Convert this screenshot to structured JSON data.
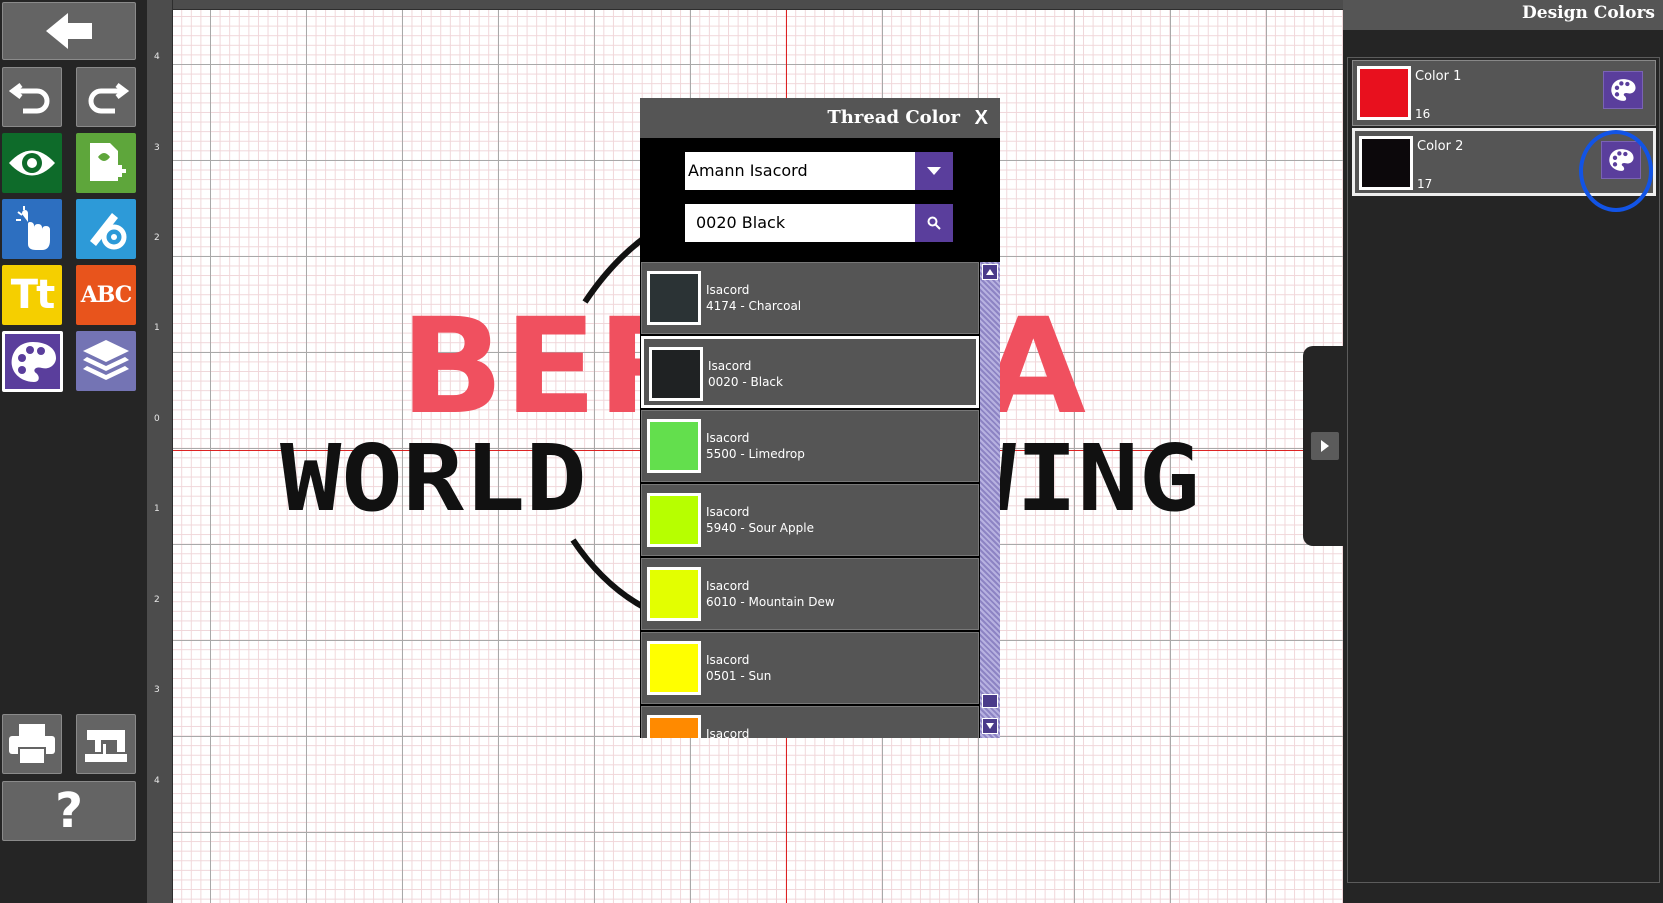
{
  "toolbar": {
    "buttons": [
      {
        "name": "back-button",
        "icon": "back-arrow-icon"
      },
      {
        "name": "undo-button",
        "icon": "undo-icon"
      },
      {
        "name": "redo-button",
        "icon": "redo-icon"
      },
      {
        "name": "view-button",
        "icon": "eye-icon"
      },
      {
        "name": "add-design-button",
        "icon": "add-design-icon"
      },
      {
        "name": "select-button",
        "icon": "pointer-hand-icon"
      },
      {
        "name": "edit-settings-button",
        "icon": "edit-gear-icon"
      },
      {
        "name": "text-button",
        "icon": "text-tt-icon",
        "label": "Tt"
      },
      {
        "name": "monogram-button",
        "icon": "monogram-abc-icon",
        "label": "ABC"
      },
      {
        "name": "colors-button",
        "icon": "palette-icon"
      },
      {
        "name": "layers-button",
        "icon": "layers-icon"
      },
      {
        "name": "print-button",
        "icon": "printer-icon"
      },
      {
        "name": "sew-button",
        "icon": "sewing-machine-icon"
      },
      {
        "name": "help-button",
        "icon": "help-icon",
        "label": "?"
      }
    ]
  },
  "ruler": {
    "left_labels": [
      "4",
      "3",
      "2",
      "1",
      "0",
      "1",
      "2",
      "3",
      "4"
    ]
  },
  "design": {
    "top_text": "BERNINA",
    "bottom_text": "WORLD OF SEWING",
    "top_color": "#f0505f",
    "bottom_color": "#111111"
  },
  "thread_dialog": {
    "title": "Thread Color",
    "close_label": "X",
    "brand": "Amann Isacord",
    "search_value": "0020 Black",
    "threads": [
      {
        "brand": "Isacord",
        "name": "4174 - Charcoal",
        "color": "#2b3335"
      },
      {
        "brand": "Isacord",
        "name": "0020 - Black",
        "color": "#1f2223",
        "selected": true
      },
      {
        "brand": "Isacord",
        "name": "5500 - Limedrop",
        "color": "#63df4d"
      },
      {
        "brand": "Isacord",
        "name": "5940 - Sour Apple",
        "color": "#b7ff00"
      },
      {
        "brand": "Isacord",
        "name": "6010 - Mountain Dew",
        "color": "#e3ff00"
      },
      {
        "brand": "Isacord",
        "name": "0501 - Sun",
        "color": "#ffff00"
      },
      {
        "brand": "Isacord",
        "name": "",
        "color": "#ff8a00"
      }
    ]
  },
  "design_colors": {
    "title": "Design Colors",
    "colors": [
      {
        "name": "Color 1",
        "count": "16",
        "color": "#e8101e"
      },
      {
        "name": "Color 2",
        "count": "17",
        "color": "#0c080b",
        "selected": true
      }
    ]
  }
}
